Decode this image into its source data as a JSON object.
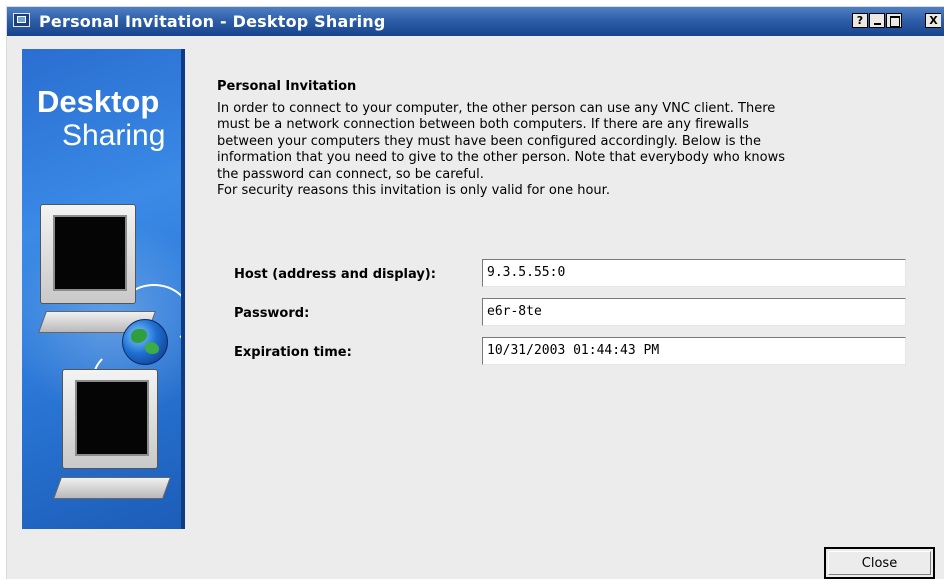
{
  "window": {
    "title": "Personal Invitation - Desktop Sharing",
    "buttons": {
      "help": "?",
      "close": "X"
    }
  },
  "sidebar": {
    "brand_line1": "Desktop",
    "brand_line2": "Sharing",
    "illustration": [
      "monitor-icon",
      "keyboard-icon",
      "globe-icon",
      "monitor-icon",
      "keyboard-icon"
    ]
  },
  "main": {
    "section_title": "Personal Invitation",
    "description_lines": [
      "In order to connect to your computer, the other person can use any VNC client. There",
      "must be a network connection between both computers. If there are any firewalls",
      "between your computers they must have been configured accordingly. Below is the",
      "information that you need to give to the other person. Note that everybody who knows",
      "the password can connect, so be careful.",
      "For security reasons this invitation is only valid for one hour."
    ],
    "fields": {
      "host": {
        "label": "Host (address and display):",
        "value": "9.3.5.55:0"
      },
      "password": {
        "label": "Password:",
        "value": "e6r-8te"
      },
      "expiration": {
        "label": "Expiration time:",
        "value": "10/31/2003 01:44:43 PM"
      }
    }
  },
  "footer": {
    "close_label": "Close",
    "close_mnemonic": "C",
    "close_rest": "lose"
  }
}
